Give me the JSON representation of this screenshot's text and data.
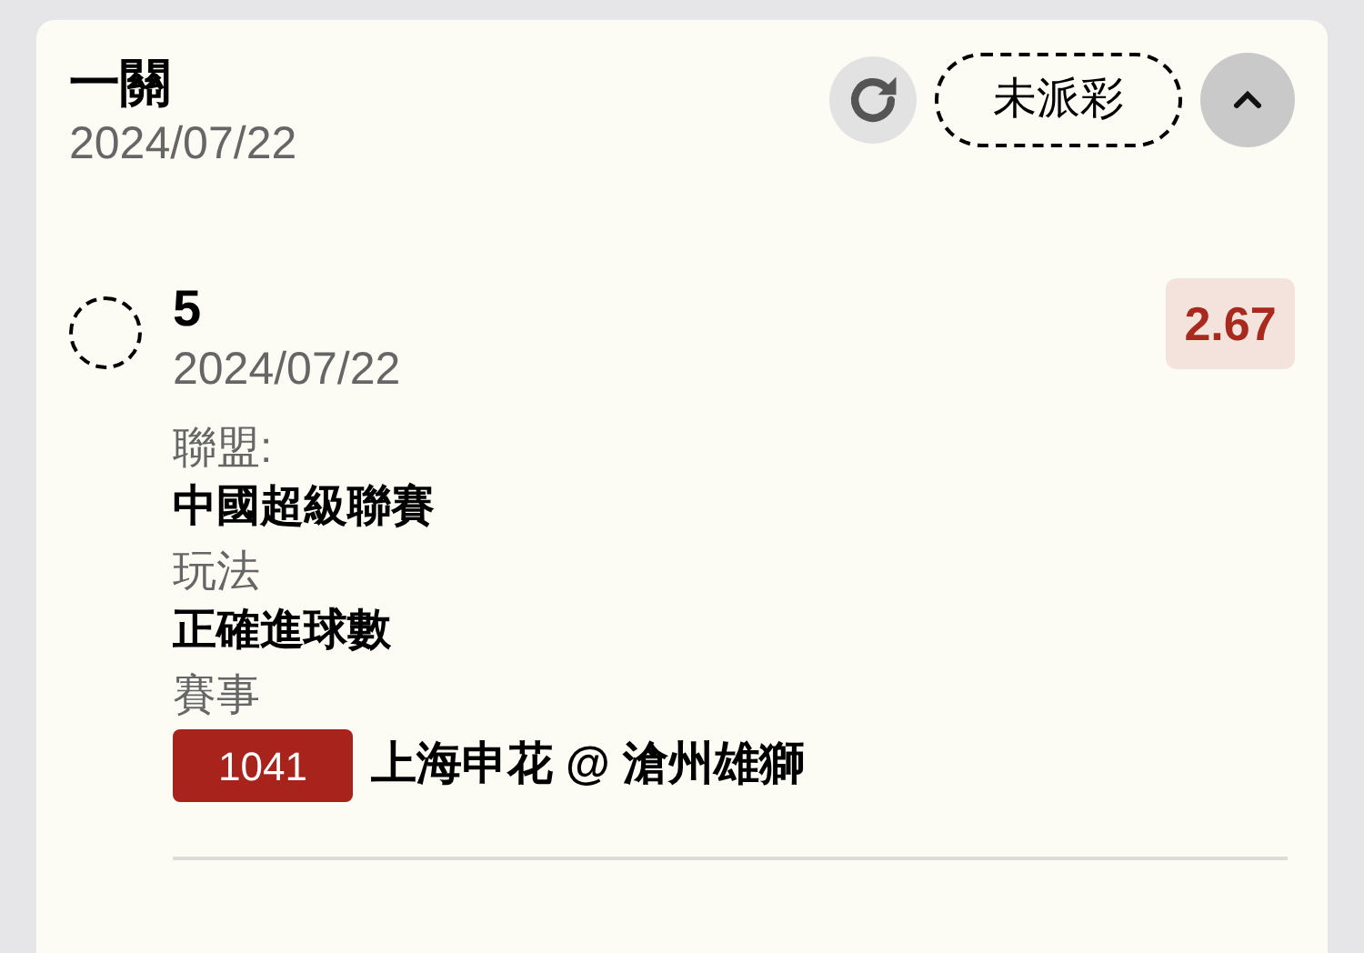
{
  "ticket": {
    "title": "一關",
    "date": "2024/07/22",
    "status": "未派彩",
    "expanded": true
  },
  "selections": [
    {
      "checked": false,
      "selection": "5",
      "date": "2024/07/22",
      "odds": "2.67",
      "fields": [
        {
          "label": "聯盟:",
          "value": "中國超級聯賽"
        },
        {
          "label": "玩法",
          "value": "正確進球數"
        }
      ],
      "match_label": "賽事",
      "match": {
        "code": "1041",
        "teams": "上海申花 @ 滄州雄獅"
      }
    }
  ]
}
